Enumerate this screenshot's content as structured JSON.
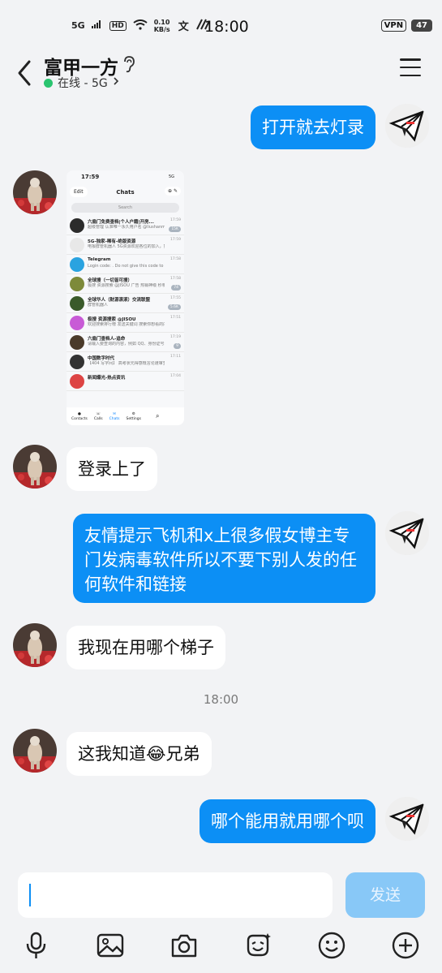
{
  "status_bar": {
    "network": "5G",
    "hd": "HD",
    "speed": "0.10 KB/s",
    "time": "18:00",
    "vpn": "VPN",
    "battery": "47"
  },
  "header": {
    "title": "富甲一方",
    "status": "在线 - 5G"
  },
  "messages": [
    {
      "from": "me",
      "text": "打开就去灯录"
    },
    {
      "from": "them",
      "type": "image"
    },
    {
      "from": "them",
      "text": "登录上了"
    },
    {
      "from": "me",
      "text": "友情提示飞机和x上很多假女博主专门发病毒软件所以不要下别人发的任何软件和链接"
    },
    {
      "from": "them",
      "text": "我现在用哪个梯子"
    },
    {
      "from": "them",
      "text": "这我知道😂兄弟"
    },
    {
      "from": "me",
      "text": "哪个能用就用哪个呗"
    }
  ],
  "timestamp": "18:00",
  "screenshot": {
    "time": "17:59",
    "status": "5G",
    "edit": "Edit",
    "title": "Chats",
    "search": "Search",
    "rows": [
      {
        "name": "六扇门免费查档|个人户籍|开房...",
        "preview": "超级管理 认准唯一永久用户名 @liushanmen...",
        "time": "17:59",
        "badge": "15K"
      },
      {
        "name": "5G-独家-稀有-绝版资源",
        "preview": "电报群管机器人 5G资源欢迎各位的加入，如需购买请私信下方...",
        "time": "17:59",
        "badge": ""
      },
      {
        "name": "Telegram",
        "preview": "Login code: . Do not give this code to anyone, even if they say they are from Telegr...",
        "time": "17:58",
        "badge": ""
      },
      {
        "name": "全球搜（一切皆可搜）",
        "preview": "极搜 资源搜索 @JISOU 广告 热销神级 秒拿1000万",
        "time": "17:58",
        "badge": "74"
      },
      {
        "name": "全球华人（财源滚滚）交流联盟",
        "preview": "群管机器人",
        "time": "17:55",
        "badge": "5.6K"
      },
      {
        "name": "极搜 资源搜索 @JISOU",
        "preview": "欢迎搜索排行榜 发送关键词 搜索你想看的内容",
        "time": "17:51",
        "badge": ""
      },
      {
        "name": "六扇门查档人-追命",
        "preview": "请输入要查询的内容，例如 QQ、身份证号、手机号、姓名等",
        "time": "17:19",
        "badge": "9"
      },
      {
        "name": "中国数字时代",
        "preview": "【404 写字间】 高考状元得感慨言论遭审查，其微博粉丝称...",
        "time": "17:11",
        "badge": ""
      },
      {
        "name": "新闻爆光-热点资讯",
        "preview": "",
        "time": "17:04",
        "badge": ""
      }
    ],
    "tabs": [
      "Contacts",
      "Calls",
      "Chats",
      "Settings"
    ]
  },
  "input": {
    "placeholder": "",
    "send_label": "发送"
  },
  "toolbar": [
    "microphone-icon",
    "image-icon",
    "camera-icon",
    "sticker-icon",
    "emoji-icon",
    "plus-icon"
  ],
  "colors": {
    "bubble_me": "#0c8ff5",
    "online": "#2ac46f",
    "send_disabled": "#88c8f7"
  }
}
